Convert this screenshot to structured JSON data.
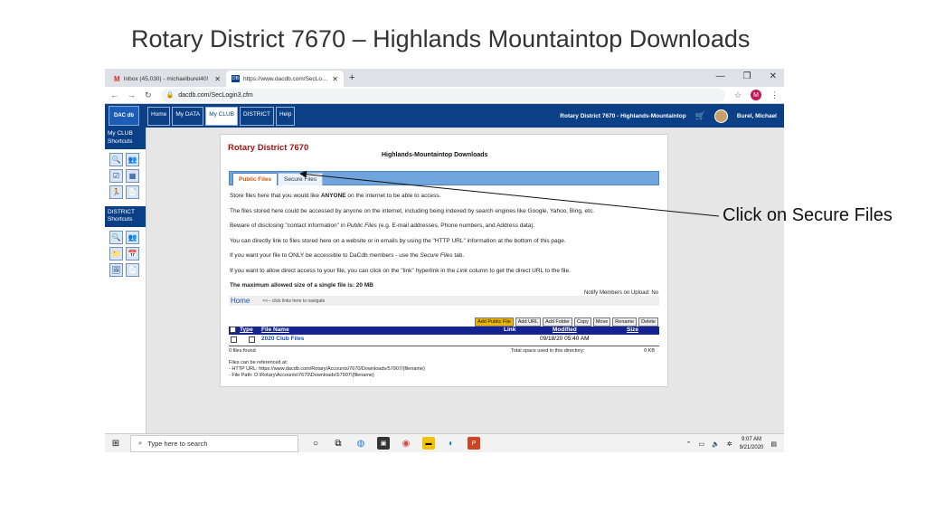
{
  "slide": {
    "title": "Rotary District 7670 – Highlands Mountaintop Downloads",
    "callout": "Click on Secure Files"
  },
  "browser": {
    "tabs": [
      {
        "label": "Inbox (45,030) - michaelburel40!",
        "icon": "gmail-icon"
      },
      {
        "label": "https://www.dacdb.com/SecLogin",
        "icon": "dacdb-icon"
      }
    ],
    "url": "dacdb.com/SecLogin3.cfm",
    "profile_initial": "M"
  },
  "app": {
    "logo": "DAC db",
    "nav": [
      "Home",
      "My DATA",
      "My CLUB",
      "DISTRICT",
      "Help"
    ],
    "active_nav": "My CLUB",
    "header_title": "Rotary District 7670 - Highlands-Mountaintop",
    "user_name": "Burel, Michael",
    "sidebar": {
      "club_heading": "My CLUB Shortcuts",
      "district_heading": "DISTRICT Shortcuts"
    }
  },
  "page": {
    "club_name": "Rotary District 7670",
    "folder_name": "Highlands-Mountaintop Downloads",
    "tabs": {
      "public": "Public Files",
      "secure": "Secure Files"
    },
    "paragraphs": {
      "p1_pre": "Store files here that you would like ",
      "p1_bold": "ANYONE",
      "p1_post": " on the internet to be able to access.",
      "p2": "The files stored here could be accessed by anyone on the internet, including being indexed by search engines like Google, Yahoo, Bing, etc.",
      "p3_pre": "Beware of disclosing \"contact information\" in ",
      "p3_em": "Public Files",
      "p3_post": " (e.g. E-mail addresses, Phone numbers, and Address data).",
      "p4": "You can directly link to files stored here on a website or in emails by using the \"HTTP URL\" information at the bottom of this page.",
      "p5_pre": "If you want your file to ONLY be accessible to DaCdb members - use the ",
      "p5_em": "Secure Files",
      "p5_post": " tab.",
      "p6_pre": "If you want to allow direct access to your file, you can click on the \"link\" hyperlink in the ",
      "p6_em": "Link",
      "p6_post": " column to get the direct URL to the file.",
      "max_size": "The maximum allowed size of a single file is: 20 MB"
    },
    "notify": "Notify Members on Upload: No",
    "home_link": "Home",
    "home_hint": "<<-- click links here to navigate",
    "actions": [
      "Add Public File",
      "Add URL",
      "Add Folder",
      "Copy",
      "Move",
      "Rename",
      "Delete"
    ],
    "table": {
      "headers": {
        "type": "Type",
        "file_name": "File Name",
        "link": "Link",
        "modified": "Modified",
        "size": "Size"
      },
      "rows": [
        {
          "name": "2020 Club Files",
          "modified": "09/18/20 05:40 AM",
          "size": ""
        }
      ]
    },
    "files_found": "0 files found",
    "space_label": "Total space used in this directory:",
    "space_value": "0 KB",
    "ref_line1": "Files can be referenced at:",
    "ref_line2": "- HTTP URL: https://www.dacdb.com/Rotary/Accounts/7670/Downloads/57907/{filename}",
    "ref_line3": "- File Path: D:\\Rotary\\Accounts\\7670\\Downloads\\57907\\{filename}"
  },
  "taskbar": {
    "search_placeholder": "Type here to search",
    "time": "9:07 AM",
    "date": "9/21/2020"
  },
  "colors": {
    "header_blue": "#0b3f86",
    "club_red": "#a31515",
    "tab_blue": "#6fa4dc",
    "table_head": "#14238f"
  }
}
